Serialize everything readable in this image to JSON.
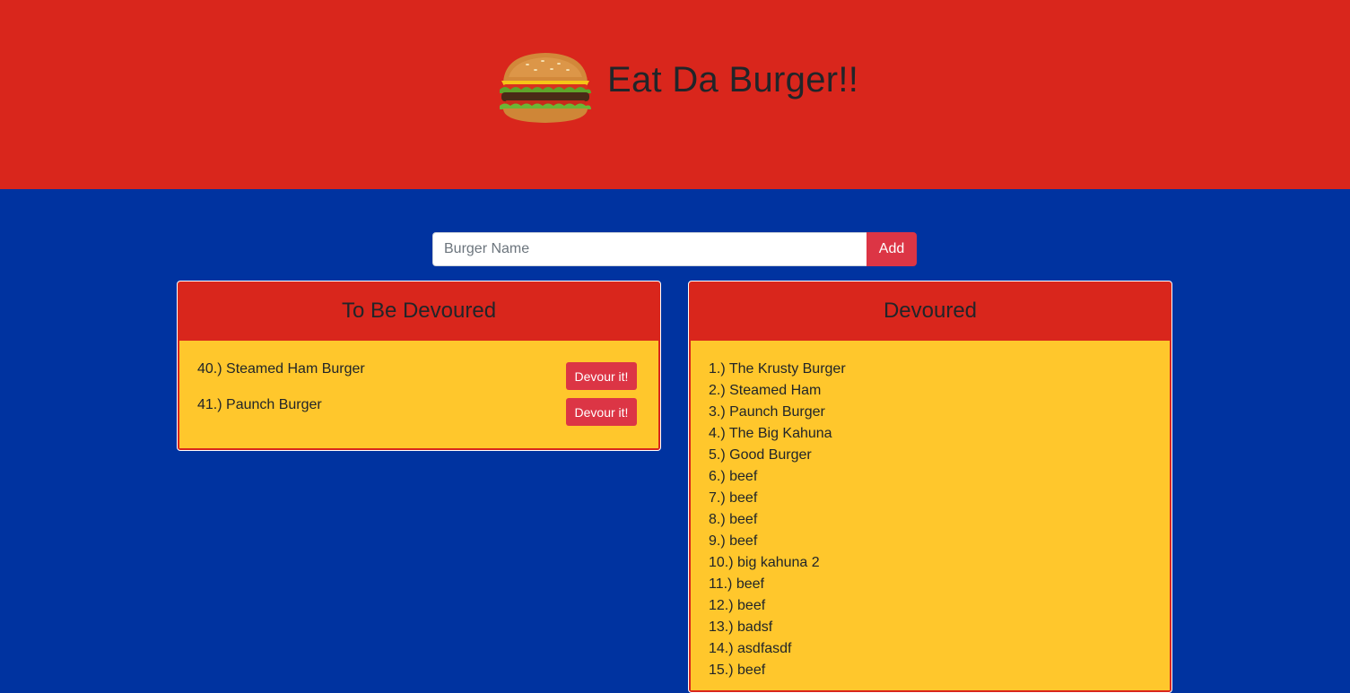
{
  "header": {
    "title": "Eat Da Burger!!",
    "logo_icon": "burger-icon",
    "background_color": "#d9261c"
  },
  "page": {
    "background_color": "#0033a0"
  },
  "form": {
    "placeholder": "Burger Name",
    "value": "",
    "add_label": "Add",
    "button_color": "#dc3545"
  },
  "to_devour": {
    "title": "To Be Devoured",
    "items": [
      {
        "label": "40.) Steamed Ham Burger",
        "button": "Devour it!"
      },
      {
        "label": "41.) Paunch Burger",
        "button": "Devour it!"
      }
    ]
  },
  "devoured": {
    "title": "Devoured",
    "items": [
      "1.) The Krusty Burger",
      "2.) Steamed Ham",
      "3.) Paunch Burger",
      "4.) The Big Kahuna",
      "5.) Good Burger",
      "6.) beef",
      "7.) beef",
      "8.) beef",
      "9.) beef",
      "10.) big kahuna 2",
      "11.) beef",
      "12.) beef",
      "13.) badsf",
      "14.) asdfasdf",
      "15.) beef"
    ]
  },
  "colors": {
    "panel_body": "#ffc72c",
    "panel_header": "#d9261c"
  }
}
